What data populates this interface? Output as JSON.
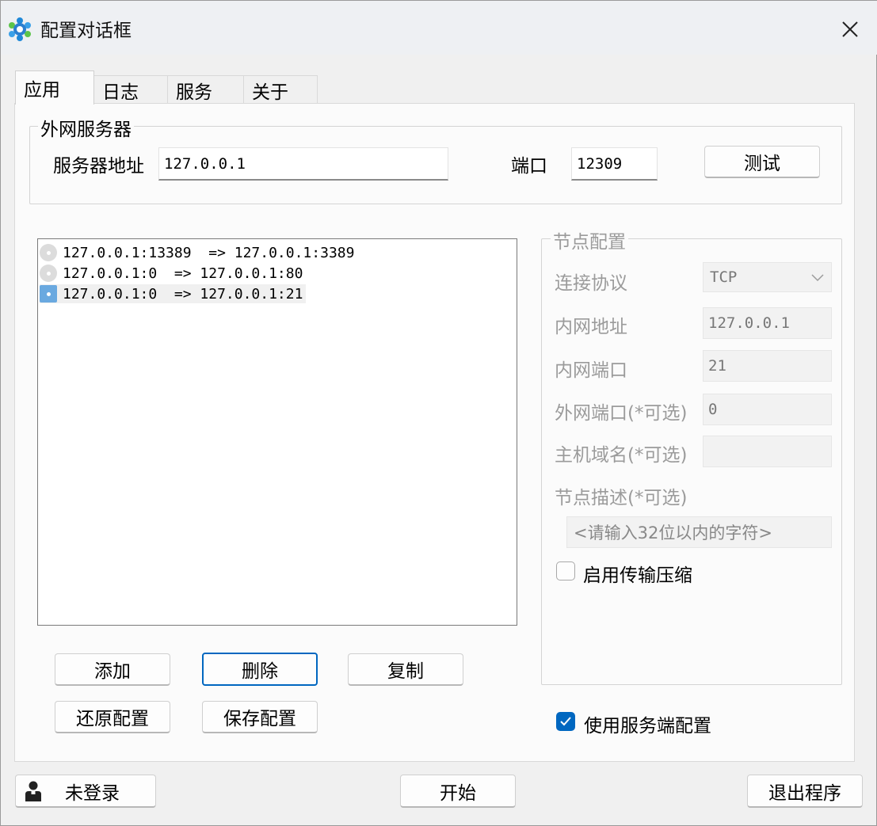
{
  "window": {
    "title": "配置对话框",
    "close_glyph": "×"
  },
  "tabs": [
    {
      "label": "应用",
      "active": true
    },
    {
      "label": "日志",
      "active": false
    },
    {
      "label": "服务",
      "active": false
    },
    {
      "label": "关于",
      "active": false
    }
  ],
  "server": {
    "group_title": "外网服务器",
    "address_label": "服务器地址",
    "address_value": "127.0.0.1",
    "port_label": "端口",
    "port_value": "12309",
    "test_button": "测试"
  },
  "mappings": [
    {
      "text": "127.0.0.1:13389  => 127.0.0.1:3389",
      "selected": false
    },
    {
      "text": "127.0.0.1:0  => 127.0.0.1:80",
      "selected": false
    },
    {
      "text": "127.0.0.1:0  => 127.0.0.1:21",
      "selected": true
    }
  ],
  "node": {
    "group_title": "节点配置",
    "protocol_label": "连接协议",
    "protocol_value": "TCP",
    "local_addr_label": "内网地址",
    "local_addr_value": "127.0.0.1",
    "local_port_label": "内网端口",
    "local_port_value": "21",
    "remote_port_label": "外网端口(*可选)",
    "remote_port_value": "0",
    "domain_label": "主机域名(*可选)",
    "domain_value": "",
    "desc_label": "节点描述(*可选)",
    "desc_placeholder": "<请输入32位以内的字符>",
    "compress_label": "启用传输压缩",
    "compress_checked": false
  },
  "actions": {
    "add": "添加",
    "delete": "删除",
    "copy": "复制",
    "restore": "还原配置",
    "save": "保存配置"
  },
  "use_server_config": {
    "label": "使用服务端配置",
    "checked": true
  },
  "footer": {
    "login_status": "未登录",
    "start": "开始",
    "exit": "退出程序"
  },
  "colors": {
    "accent": "#0067c0",
    "disabled_text": "#9b9b9b"
  }
}
